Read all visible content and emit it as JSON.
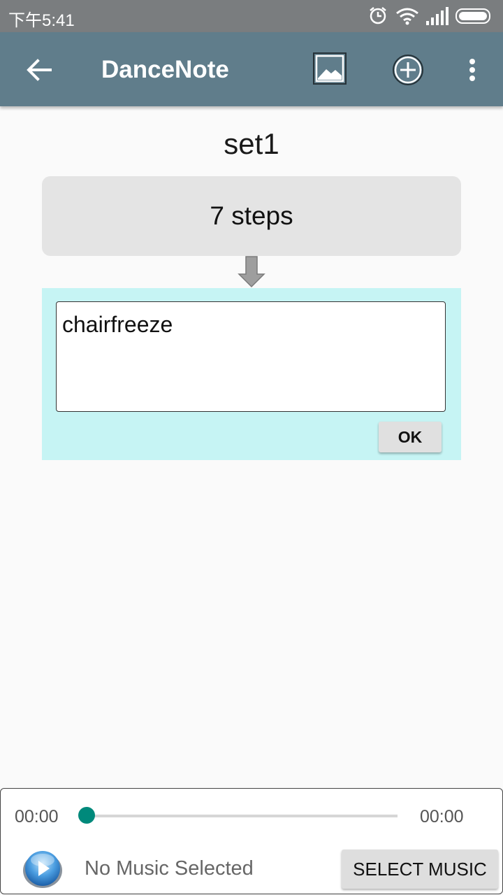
{
  "status_bar": {
    "time": "下午5:41"
  },
  "toolbar": {
    "title": "DanceNote",
    "icons": [
      "arrow-back-icon",
      "image-icon",
      "add-circle-icon",
      "more-vert-icon"
    ],
    "color": "#607d8b"
  },
  "set": {
    "title": "set1",
    "steps_label": "7 steps"
  },
  "editor": {
    "value": "chairfreeze",
    "ok_label": "OK",
    "panel_color": "#c6f4f4"
  },
  "player": {
    "start_time": "00:00",
    "end_time": "00:00",
    "progress": 0,
    "music_label": "No Music Selected",
    "select_label": "SELECT MUSIC",
    "accent": "#00897b"
  }
}
